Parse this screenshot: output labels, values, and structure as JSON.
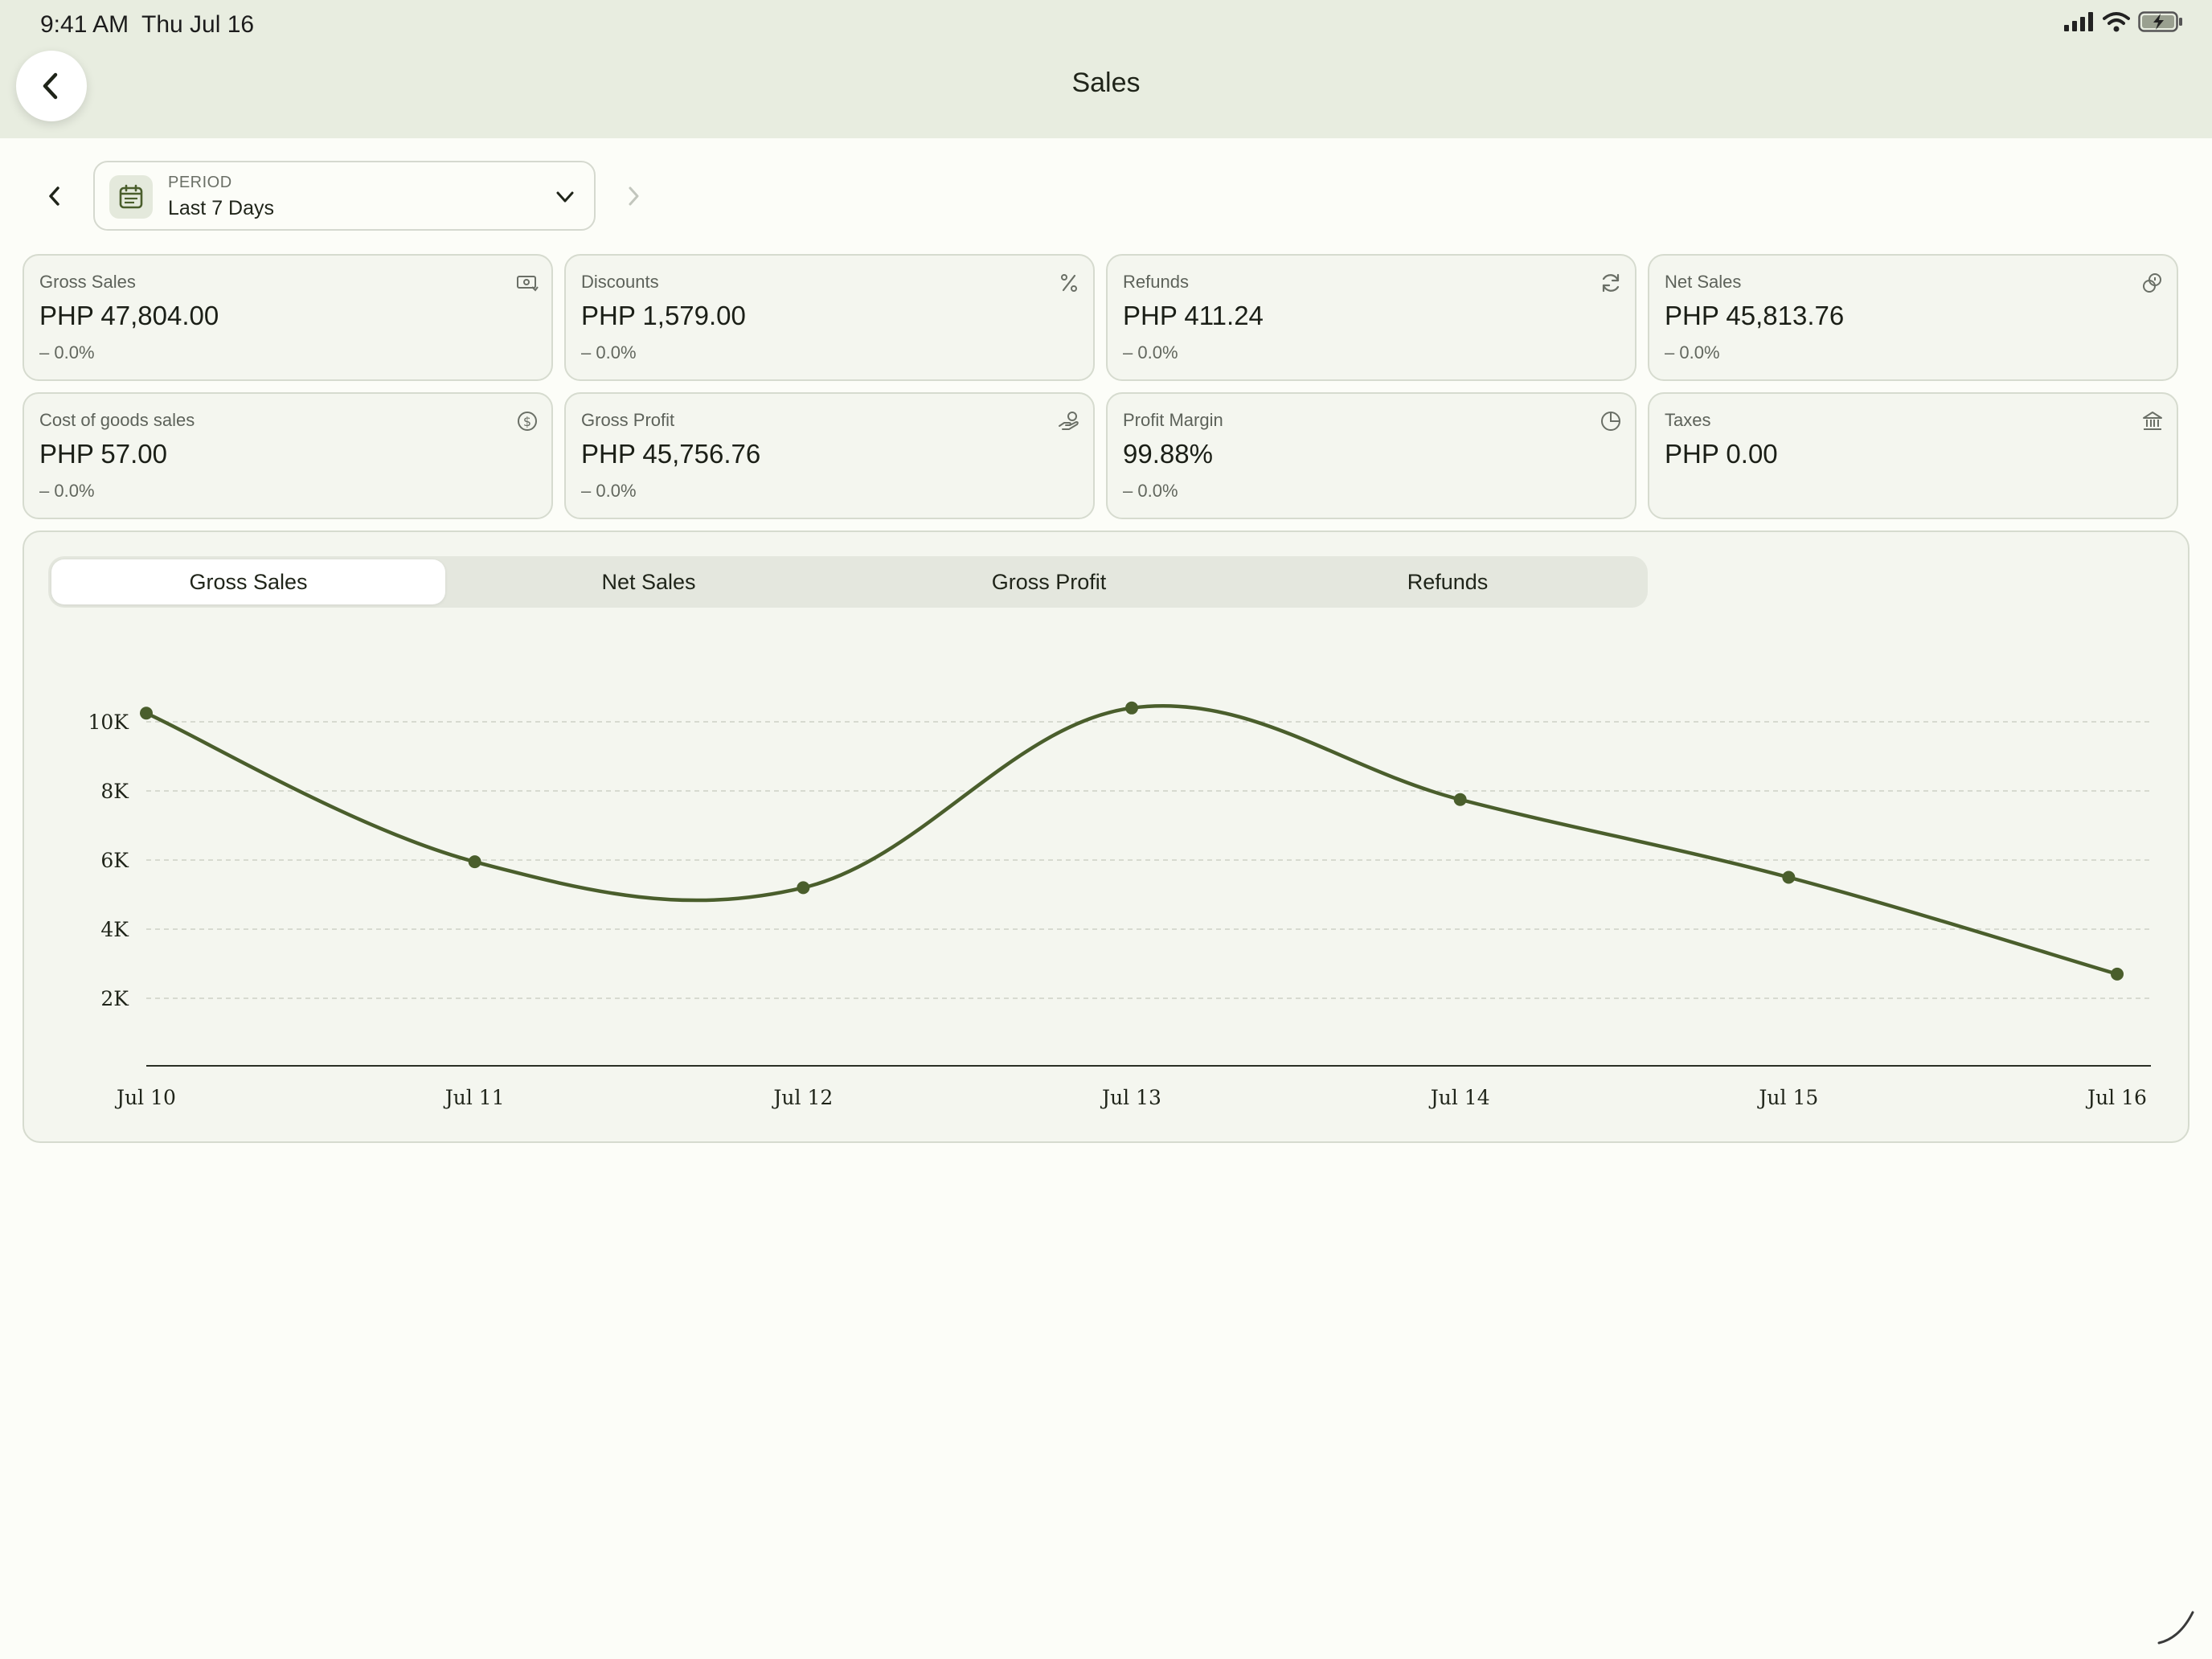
{
  "status_bar": {
    "time": "9:41 AM",
    "date": "Thu Jul 16"
  },
  "header": {
    "title": "Sales"
  },
  "period": {
    "caption": "PERIOD",
    "value": "Last 7 Days"
  },
  "cards": [
    {
      "label": "Gross Sales",
      "value": "PHP 47,804.00",
      "change": "0.0%",
      "icon": "cash-icon"
    },
    {
      "label": "Discounts",
      "value": "PHP 1,579.00",
      "change": "0.0%",
      "icon": "percent-icon"
    },
    {
      "label": "Refunds",
      "value": "PHP 411.24",
      "change": "0.0%",
      "icon": "refresh-icon"
    },
    {
      "label": "Net Sales",
      "value": "PHP 45,813.76",
      "change": "0.0%",
      "icon": "coins-icon"
    },
    {
      "label": "Cost of goods sales",
      "value": "PHP 57.00",
      "change": "0.0%",
      "icon": "dollar-circle-icon"
    },
    {
      "label": "Gross Profit",
      "value": "PHP 45,756.76",
      "change": "0.0%",
      "icon": "hand-coin-icon"
    },
    {
      "label": "Profit Margin",
      "value": "99.88%",
      "change": "0.0%",
      "icon": "pie-chart-icon"
    },
    {
      "label": "Taxes",
      "value": "PHP 0.00",
      "change": "",
      "icon": "bank-icon"
    }
  ],
  "tabs": [
    {
      "label": "Gross Sales",
      "active": true
    },
    {
      "label": "Net Sales",
      "active": false
    },
    {
      "label": "Gross Profit",
      "active": false
    },
    {
      "label": "Refunds",
      "active": false
    }
  ],
  "colors": {
    "accent": "#4a5e2c",
    "header_bg": "#e8ede0",
    "card_bg": "#f4f6ef"
  },
  "chart_data": {
    "type": "line",
    "title": "",
    "xlabel": "",
    "ylabel": "",
    "categories": [
      "Jul 10",
      "Jul 11",
      "Jul 12",
      "Jul 13",
      "Jul 14",
      "Jul 15",
      "Jul 16"
    ],
    "series": [
      {
        "values": [
          10250,
          5950,
          5200,
          10400,
          7750,
          5500,
          2700
        ]
      }
    ],
    "yticks": [
      2000,
      4000,
      6000,
      8000,
      10000
    ],
    "ytick_labels": [
      "2K",
      "4K",
      "6K",
      "8K",
      "10K"
    ],
    "ylim": [
      0,
      11000
    ],
    "grid": "horizontal dashed",
    "smooth": true,
    "markers": true
  }
}
